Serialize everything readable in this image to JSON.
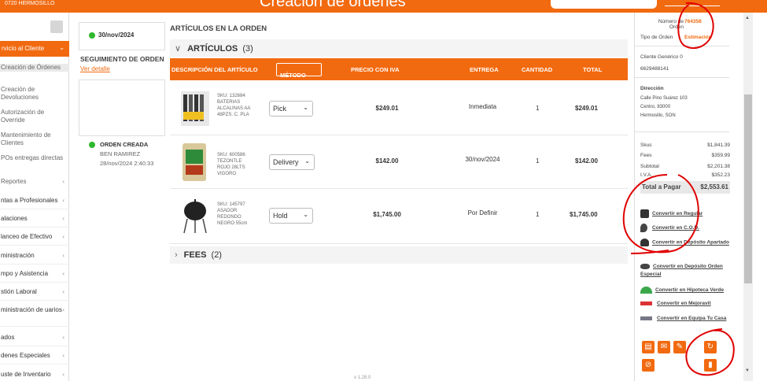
{
  "header": {
    "store": "0720 HERMOSILLO",
    "title": "Creación de órdenes"
  },
  "sidebar": {
    "active_label": "rvicio al Cliente",
    "subitems": [
      "Creación de Órdenes",
      "Creación de Devoluciones",
      "Autorización de Override",
      "Mantenimiento de Clientes",
      "POs entregas directas",
      "Reportes"
    ],
    "items": [
      "ntas a Profesionales",
      "alaciones",
      "lanceo de Efectivo",
      "ministración",
      "mpo y Asistencia",
      "stión Laboral",
      "ministración de uarios",
      "ados",
      "denes Especiales",
      "uste de Inventario"
    ]
  },
  "tracking": {
    "date": "30/nov/2024",
    "title": "SEGUIMIENTO DE ORDEN",
    "detail_link": "Ver detalle",
    "event": "ORDEN CREADA",
    "user": "BEN RAMIREZ",
    "timestamp": "28/nov/2024 2:40:33"
  },
  "articles": {
    "section_title": "ARTÍCULOS EN LA ORDEN",
    "group_label": "ARTÍCULOS",
    "group_count": "(3)",
    "fees_label": "FEES",
    "fees_count": "(2)",
    "columns": {
      "desc": "DESCRIPCIÓN DEL ARTÍCULO",
      "metodo": "MÉTODO",
      "precio": "PRECIO CON IVA",
      "entrega": "ENTREGA",
      "cantidad": "CANTIDAD",
      "total": "TOTAL"
    },
    "rows": [
      {
        "sku": "SKU: 132684",
        "name": "BATERIAS ALCALINAS AA 48PZS. C. PLA",
        "method": "Pick",
        "price": "$249.01",
        "delivery": "Inmediata",
        "qty": "1",
        "total": "$249.01"
      },
      {
        "sku": "SKU: 600586",
        "name": "TEZONTLE ROJO 28LTS VIGORO",
        "method": "Delivery",
        "price": "$142.00",
        "delivery": "30/nov/2024",
        "qty": "1",
        "total": "$142.00"
      },
      {
        "sku": "SKU: 145797",
        "name": "ASADOR REDONDO NEGRO 55cm",
        "method": "Hold",
        "price": "$1,745.00",
        "delivery": "Por Definir",
        "qty": "1",
        "total": "$1,745.00"
      }
    ]
  },
  "order_panel": {
    "order_number_label": "Número de Orden",
    "order_number": "764358",
    "order_type_label": "Tipo de Orden",
    "order_type": "Estimación",
    "customer_label": "Cliente Genérico 0",
    "customer_phone": "6629488141",
    "address_label": "Dirección",
    "address_lines": [
      "Calle Pino Suárez 103",
      "Centro, 83000",
      "Hermosillo, SON"
    ],
    "summary": [
      {
        "label": "Skus",
        "value": "$1,841.39"
      },
      {
        "label": "Fees",
        "value": "$359.99"
      },
      {
        "label": "Subtotal",
        "value": "$2,201.38"
      },
      {
        "label": "I.V.A.",
        "value": "$352.23"
      }
    ],
    "total_label": "Total a Pagar",
    "total_value": "$2,553.61",
    "conversions": [
      "Convertir en Regular",
      "Convertir en C.O.D.",
      "Convertir en Depósito Apartado",
      "Convertir en Depósito Orden Especial",
      "Convertir en Hipoteca Verde",
      "Convertir en Mejoravit",
      "Convertir en Equipa Tu Casa"
    ],
    "actions": [
      "printer-icon",
      "mail-icon",
      "pencil-icon",
      "refresh-icon",
      "cancel-icon",
      "trash-icon"
    ]
  },
  "footer": {
    "version": "v 1.28.0"
  },
  "colors": {
    "accent": "#f26a10",
    "annotation": "#e00000",
    "success": "#2eb82e"
  }
}
